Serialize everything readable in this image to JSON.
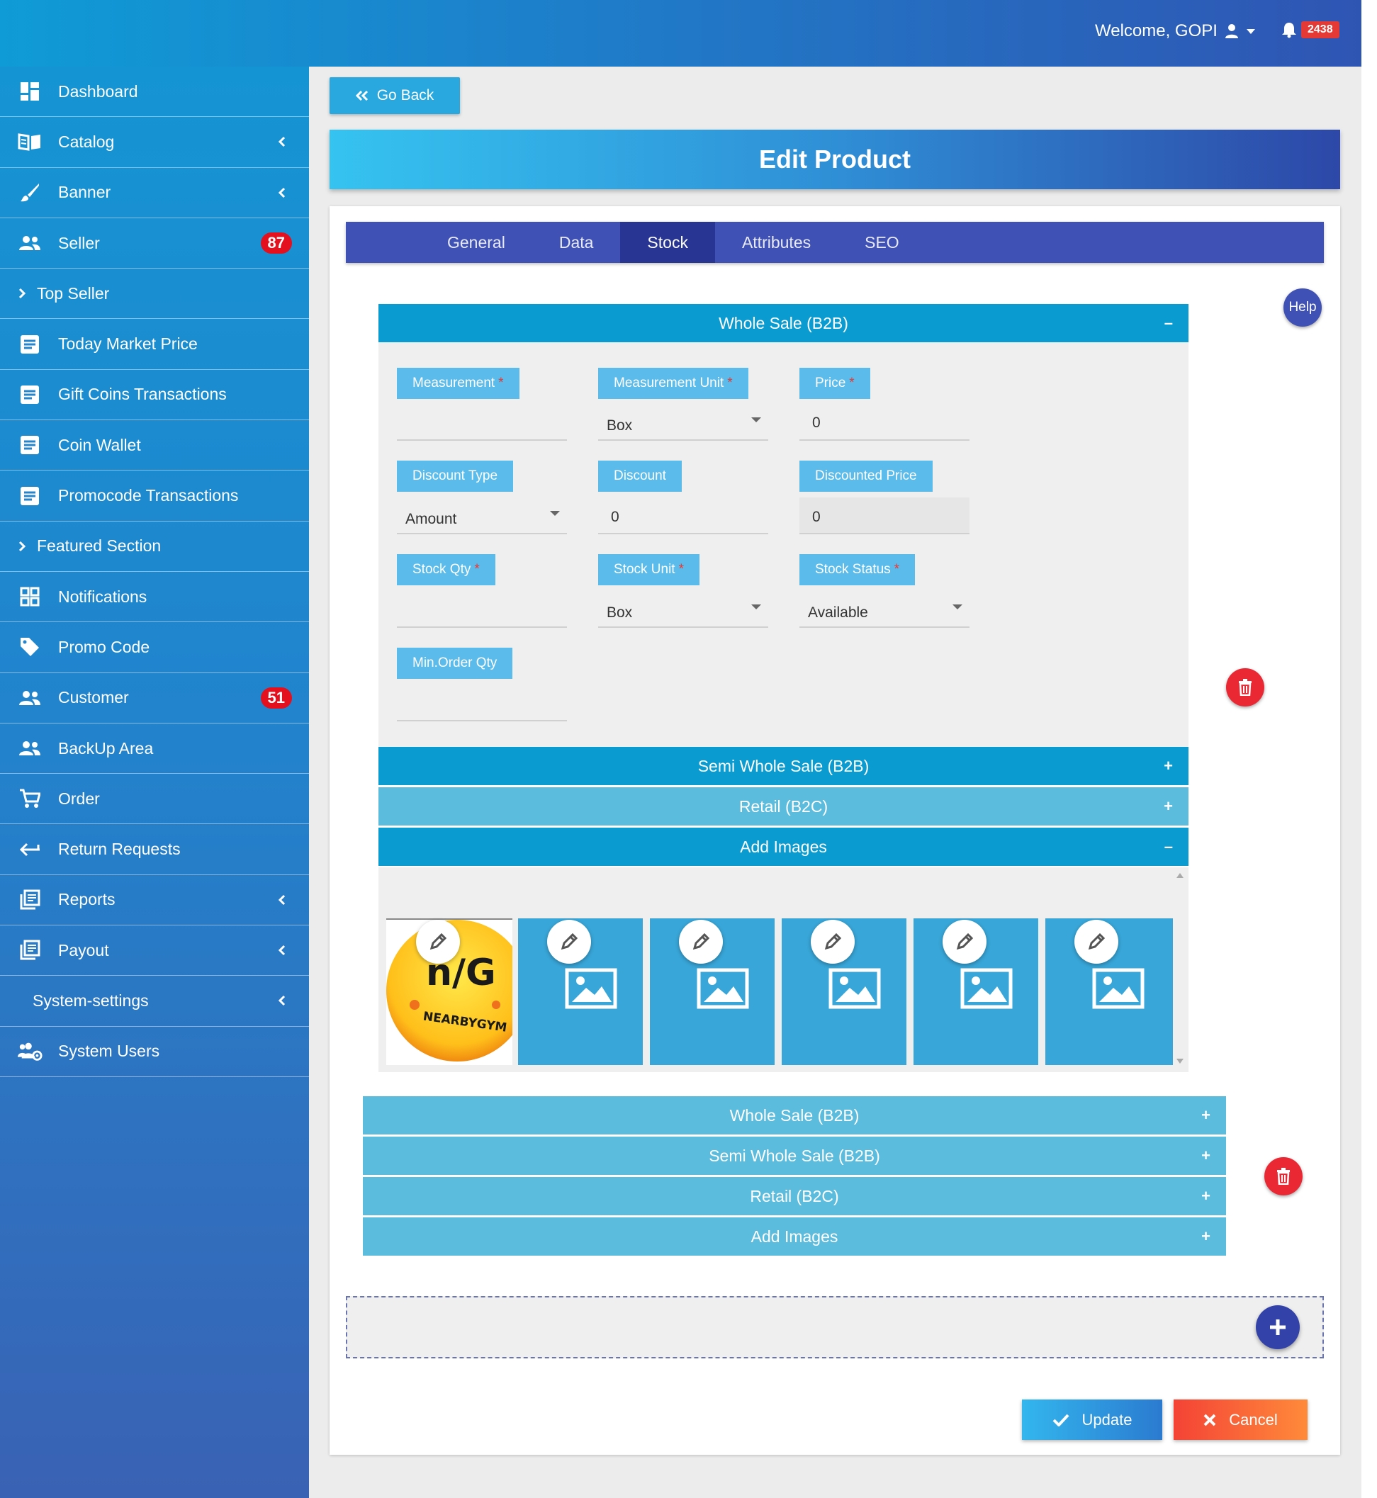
{
  "header": {
    "welcome": "Welcome, GOPI",
    "notification_count": "2438"
  },
  "sidebar": {
    "items": [
      {
        "label": "Dashboard",
        "icon": "dashboard-icon"
      },
      {
        "label": "Catalog",
        "icon": "book-icon"
      },
      {
        "label": "Banner",
        "icon": "brush-icon"
      },
      {
        "label": "Seller",
        "icon": "people-icon",
        "badge": "87"
      },
      {
        "label": "Top Seller",
        "icon": "chevron-right-icon"
      },
      {
        "label": "Today Market Price",
        "icon": "document-icon"
      },
      {
        "label": "Gift Coins Transactions",
        "icon": "document-icon"
      },
      {
        "label": "Coin Wallet",
        "icon": "document-icon"
      },
      {
        "label": "Promocode Transactions",
        "icon": "document-icon"
      },
      {
        "label": "Featured Section",
        "icon": "chevron-right-icon"
      },
      {
        "label": "Notifications",
        "icon": "grid-icon"
      },
      {
        "label": "Promo Code",
        "icon": "tag-icon"
      },
      {
        "label": "Customer",
        "icon": "people-icon",
        "badge": "51"
      },
      {
        "label": "BackUp Area",
        "icon": "people-icon"
      },
      {
        "label": "Order",
        "icon": "cart-icon"
      },
      {
        "label": "Return Requests",
        "icon": "return-icon"
      },
      {
        "label": "Reports",
        "icon": "library-icon"
      },
      {
        "label": "Payout",
        "icon": "library-icon"
      },
      {
        "label": "System-settings",
        "icon": ""
      },
      {
        "label": "System Users",
        "icon": "users-cog-icon"
      }
    ]
  },
  "page": {
    "go_back": "Go Back",
    "title": "Edit Product",
    "help": "Help"
  },
  "tabs": [
    "General",
    "Data",
    "Stock",
    "Attributes",
    "SEO"
  ],
  "active_tab": "Stock",
  "section1": {
    "wholesale": "Whole Sale (B2B)",
    "fields": {
      "measurement": {
        "label": "Measurement",
        "value": ""
      },
      "measurement_unit": {
        "label": "Measurement Unit",
        "value": "Box"
      },
      "price": {
        "label": "Price",
        "value": "0"
      },
      "discount_type": {
        "label": "Discount Type",
        "value": "Amount"
      },
      "discount": {
        "label": "Discount",
        "value": "0"
      },
      "discounted_price": {
        "label": "Discounted Price",
        "value": "0"
      },
      "stock_qty": {
        "label": "Stock Qty",
        "value": ""
      },
      "stock_unit": {
        "label": "Stock Unit",
        "value": "Box"
      },
      "stock_status": {
        "label": "Stock Status",
        "value": "Available"
      },
      "min_order_qty": {
        "label": "Min.Order Qty",
        "value": ""
      }
    },
    "semi_wholesale": "Semi Whole Sale (B2B)",
    "retail": "Retail (B2C)",
    "add_images": "Add Images",
    "logo_text": "n/G",
    "logo_sub": "NEARBYGYM"
  },
  "section2": {
    "wholesale": "Whole Sale (B2B)",
    "semi_wholesale": "Semi Whole Sale (B2B)",
    "retail": "Retail (B2C)",
    "add_images": "Add Images"
  },
  "actions": {
    "update": "Update",
    "cancel": "Cancel"
  },
  "colors": {
    "accent": "#3f51b5",
    "accordion": "#0a9bd1",
    "accordion_light": "#5bbcdd",
    "danger": "#e92834"
  }
}
